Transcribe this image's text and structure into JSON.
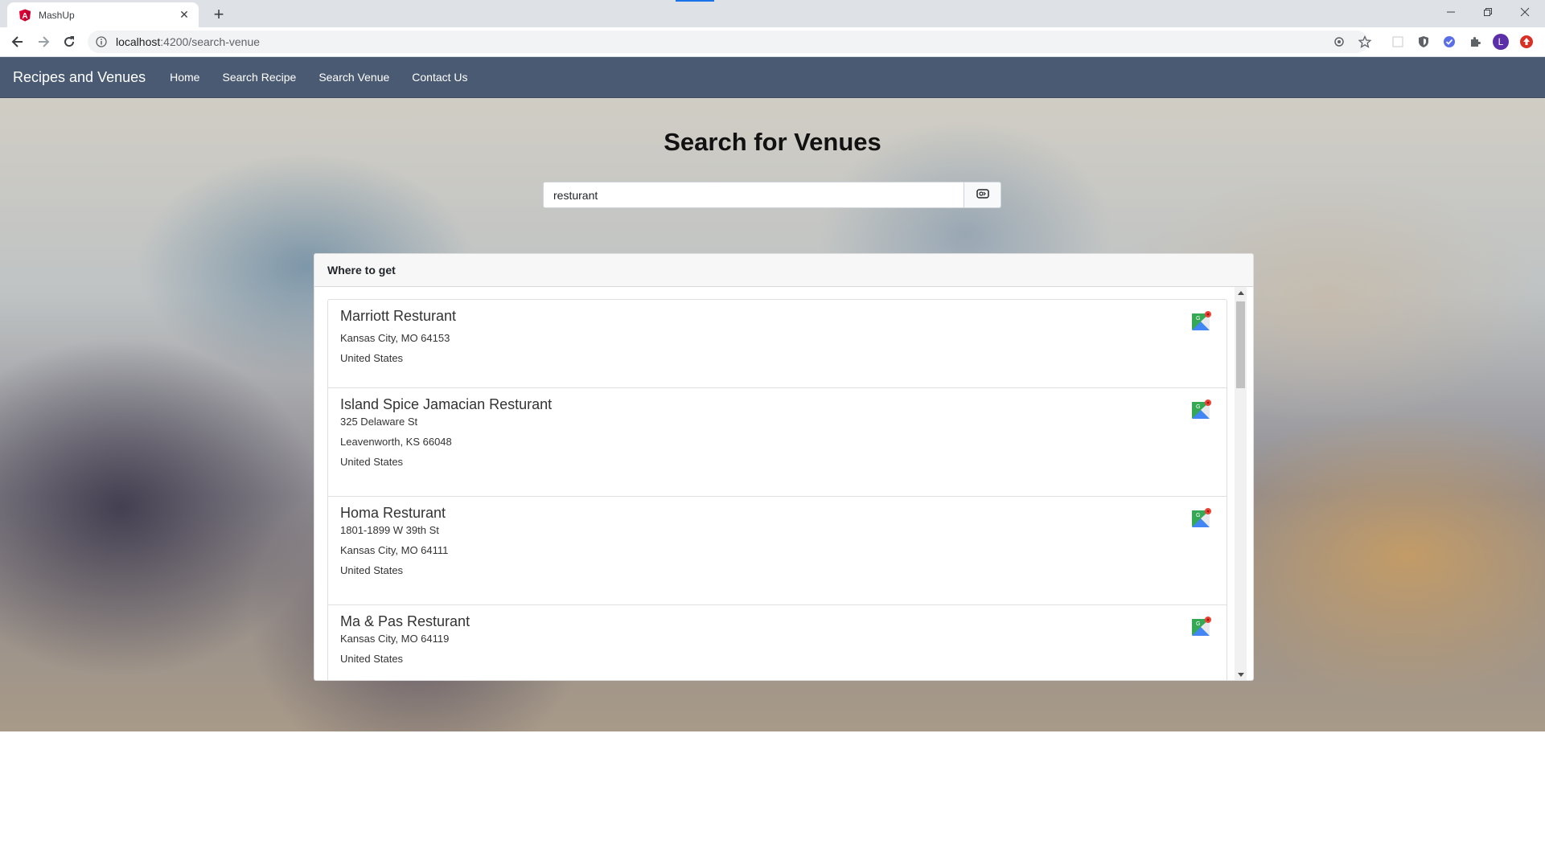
{
  "browser": {
    "tab_title": "MashUp",
    "tab_close": "✕",
    "new_tab": "+",
    "url_host": "localhost",
    "url_path": ":4200/search-venue",
    "profile_initial": "L"
  },
  "navbar": {
    "brand": "Recipes and Venues",
    "links": [
      "Home",
      "Search Recipe",
      "Search Venue",
      "Contact Us"
    ]
  },
  "page": {
    "title": "Search for Venues"
  },
  "search": {
    "value": "resturant"
  },
  "results": {
    "header": "Where to get",
    "venues": [
      {
        "name": "Marriott Resturant",
        "lines": [
          "Kansas City, MO 64153",
          "United States"
        ]
      },
      {
        "name": "Island Spice Jamacian Resturant",
        "lines": [
          "325 Delaware St",
          "Leavenworth, KS 66048",
          "United States"
        ]
      },
      {
        "name": "Homa Resturant",
        "lines": [
          "1801-1899 W 39th St",
          "Kansas City, MO 64111",
          "United States"
        ]
      },
      {
        "name": "Ma & Pas Resturant",
        "lines": [
          "Kansas City, MO 64119",
          "United States"
        ]
      }
    ]
  },
  "colors": {
    "navbar_bg": "#4a5a72",
    "accent_blue": "#1a73e8",
    "angular_red": "#dd0031"
  }
}
